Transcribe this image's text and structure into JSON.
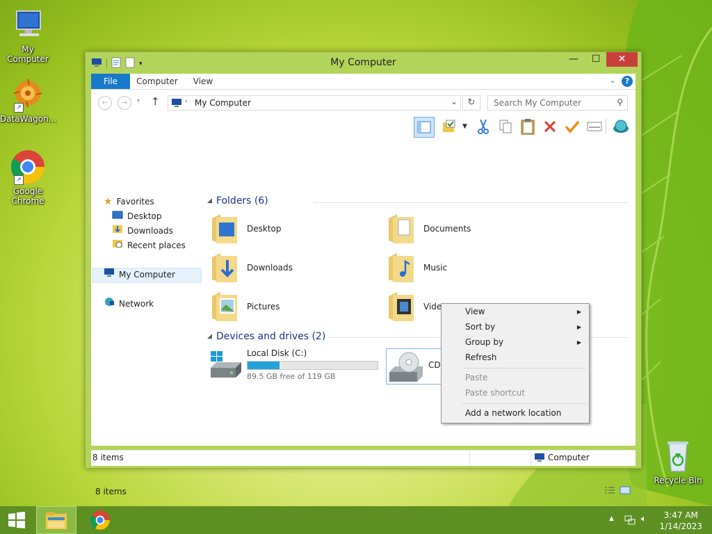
{
  "desktop": {
    "icons": [
      {
        "label": "My Computer",
        "icon": "computer-icon"
      },
      {
        "label": "DataWagon...",
        "icon": "datawagon-icon"
      },
      {
        "label": "Google Chrome",
        "icon": "chrome-icon"
      },
      {
        "label": "Recycle Bin",
        "icon": "recycle-bin-icon"
      }
    ]
  },
  "window": {
    "title": "My Computer",
    "tabs": {
      "file": "File",
      "computer": "Computer",
      "view": "View"
    },
    "address": "My Computer",
    "search_placeholder": "Search My Computer"
  },
  "navpane": {
    "favorites": "Favorites",
    "desktop": "Desktop",
    "downloads": "Downloads",
    "recent": "Recent places",
    "mycomputer": "My Computer",
    "network": "Network"
  },
  "main": {
    "folders_header": "Folders (6)",
    "folders": [
      "Desktop",
      "Documents",
      "Downloads",
      "Music",
      "Pictures",
      "Videos"
    ],
    "devices_header": "Devices and drives (2)",
    "drives": [
      {
        "name": "Local Disk (C:)",
        "free": "89.5 GB free of 119 GB",
        "used_fraction": 0.248
      },
      {
        "name": "CD"
      }
    ]
  },
  "footer": {
    "item_count": "8 items",
    "status_count": "8 items",
    "status_location": "Computer"
  },
  "context_menu": {
    "view": "View",
    "sort_by": "Sort by",
    "group_by": "Group by",
    "refresh": "Refresh",
    "paste": "Paste",
    "paste_shortcut": "Paste shortcut",
    "add_network": "Add a network location"
  },
  "taskbar": {
    "time": "3:47 AM",
    "date": "1/14/2023"
  },
  "colors": {
    "accent": "#1979ca",
    "close": "#c7403a",
    "taskbar": "#5d8f23",
    "drive_bar": "#26a0da"
  }
}
